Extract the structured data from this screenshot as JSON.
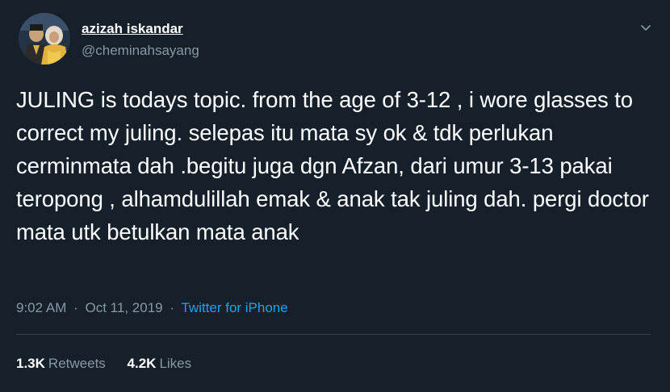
{
  "author": {
    "display_name": "azizah iskandar",
    "handle": "@cheminahsayang"
  },
  "tweet": {
    "text": "JULING is todays topic. from the age of 3-12 , i wore glasses to correct my juling. selepas itu mata sy ok & tdk perlukan cerminmata dah .begitu juga dgn Afzan, dari umur 3-13 pakai teropong , alhamdulillah emak & anak tak juling dah. pergi doctor mata utk betulkan mata anak",
    "time": "9:02 AM",
    "separator": "·",
    "date": "Oct 11, 2019",
    "source": "Twitter for iPhone"
  },
  "stats": {
    "retweets_count": "1.3K",
    "retweets_label": "Retweets",
    "likes_count": "4.2K",
    "likes_label": "Likes"
  },
  "icons": {
    "menu": "chevron-down-icon"
  },
  "colors": {
    "background": "#15202b",
    "text": "#ffffff",
    "muted": "#8899a6",
    "link": "#1da1f2",
    "divider": "#38444d"
  }
}
